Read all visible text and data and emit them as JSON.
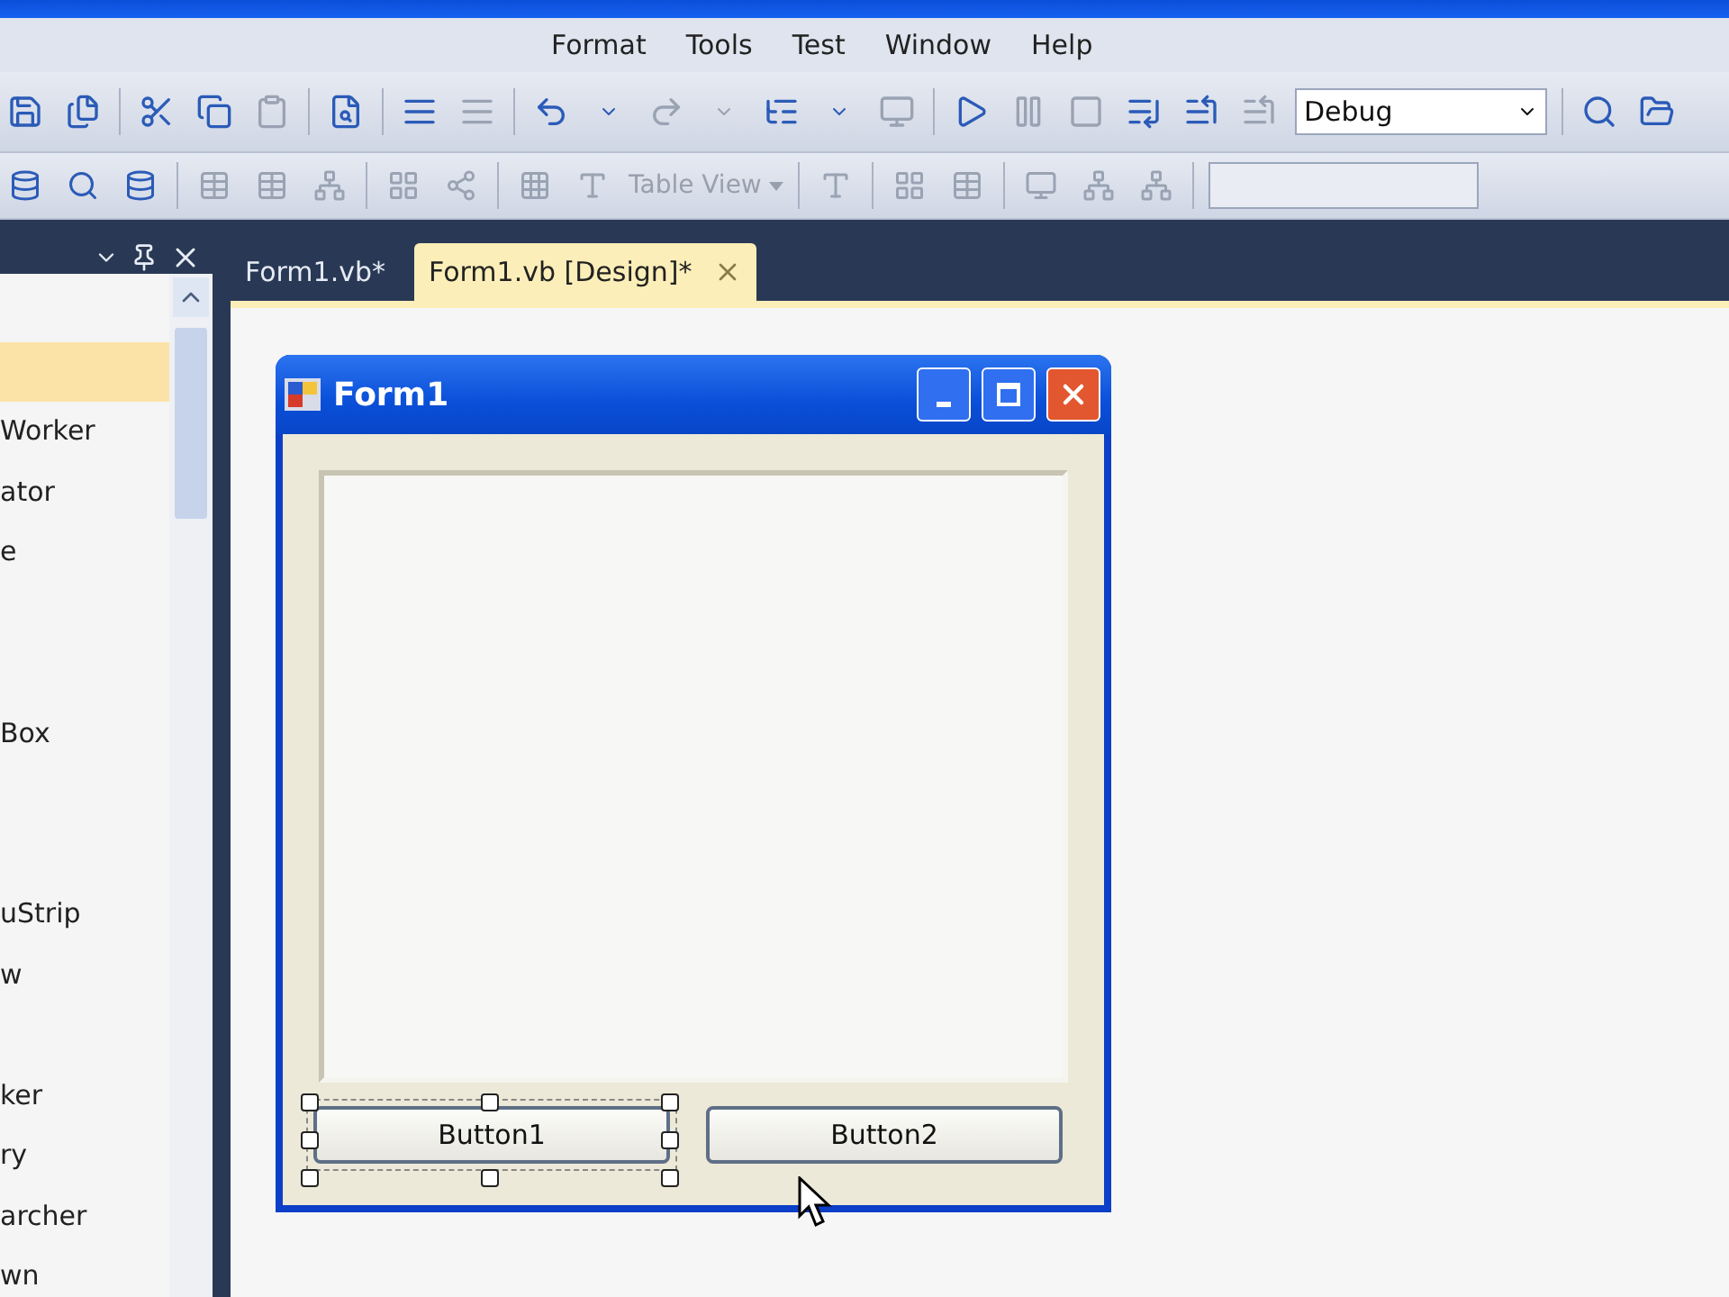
{
  "menu": [
    "Format",
    "Tools",
    "Test",
    "Window",
    "Help"
  ],
  "toolbar": {
    "configuration": "Debug",
    "table_view": {
      "label": "Table View",
      "disabled": true
    }
  },
  "toolbox": {
    "items": [
      {
        "selected": false
      },
      {
        "selected": true
      },
      {
        "label": "Worker",
        "selected": false
      },
      {
        "label": "ator",
        "selected": false
      },
      {
        "label": "e",
        "selected": false
      },
      {
        "selected": false
      },
      {
        "selected": false
      },
      {
        "label": "Box",
        "selected": false
      },
      {
        "selected": false
      },
      {
        "selected": false
      },
      {
        "label": "uStrip",
        "selected": false
      },
      {
        "label": "w",
        "selected": false
      },
      {
        "selected": false
      },
      {
        "label": "ker",
        "selected": false
      },
      {
        "label": "ry",
        "selected": false
      },
      {
        "label": "archer",
        "selected": false
      },
      {
        "label": "wn",
        "selected": false
      }
    ]
  },
  "tabs": [
    {
      "label": "Form1.vb*",
      "selected": false
    },
    {
      "label": "Form1.vb [Design]*",
      "selected": true
    }
  ],
  "form": {
    "title": "Form1",
    "buttons": [
      {
        "label": "Button1",
        "selected": true
      },
      {
        "label": "Button2",
        "selected": false
      }
    ]
  }
}
